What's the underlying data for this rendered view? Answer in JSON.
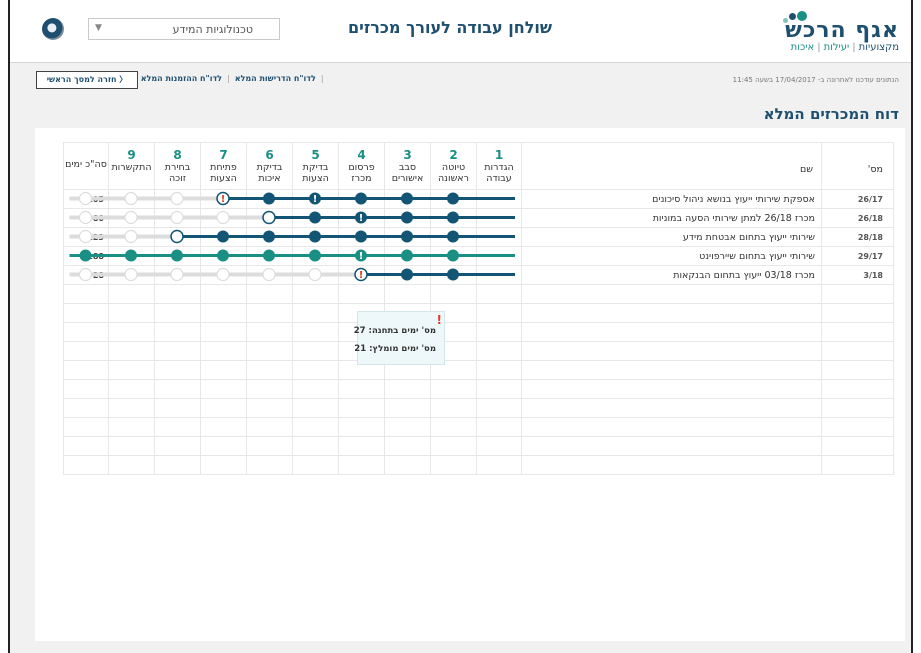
{
  "header": {
    "logo_name": "אגף הרכש",
    "logo_tagline": [
      "מקצועיות",
      "יעילות",
      "איכות"
    ],
    "app_title": "שולחן עבודה לעורך מכרזים",
    "department_select": "טכנולוגיות המידע"
  },
  "toolbar": {
    "last_updated": "הנתונים עודכנו לאחרונה ב- 17/04/2017 בשעה 11:45",
    "link_requirements": "לדו\"ח הדרישות המלא",
    "link_orders": "לדו\"ח ההזמנות המלא",
    "back_button": "חזרה למסך הראשי"
  },
  "report_title": "דוח המכרזים המלא",
  "table": {
    "col_num": "מס'",
    "col_name": "שם",
    "col_total": "סה\"כ ימים",
    "stages": [
      {
        "num": "1",
        "label": "הגדרות עבודה"
      },
      {
        "num": "2",
        "label": "טיוטה ראשונה"
      },
      {
        "num": "3",
        "label": "סבב אישורים"
      },
      {
        "num": "4",
        "label": "פרסום מכרז"
      },
      {
        "num": "5",
        "label": "בדיקת הצעות"
      },
      {
        "num": "6",
        "label": "בדיקת איכות"
      },
      {
        "num": "7",
        "label": "פתיחת הצעות"
      },
      {
        "num": "8",
        "label": "בחירת זוכה"
      },
      {
        "num": "9",
        "label": "התקשרות"
      }
    ],
    "rows": [
      {
        "num": "26/17",
        "name": "אספקת שירותי ייעוץ בנושא ניהול סיכונים",
        "total": "105",
        "completed": 5,
        "current": 6,
        "alerts": [
          4,
          6
        ],
        "color": "#135574"
      },
      {
        "num": "26/18",
        "name": "מכרז 26/18 למתן שירותי הסעה במוניות",
        "total": "80",
        "completed": 4,
        "current": 5,
        "alerts": [
          3
        ],
        "color": "#135574"
      },
      {
        "num": "28/18",
        "name": "שירותי ייעוץ בתחום אבטחת מידע",
        "total": "123",
        "completed": 6,
        "current": 7,
        "alerts": [],
        "color": "#135574"
      },
      {
        "num": "29/17",
        "name": "שירותי ייעוץ בתחום שיירפוינט",
        "total": "188",
        "completed": 9,
        "current": 0,
        "alerts": [
          3
        ],
        "color": "#1a8f84"
      },
      {
        "num": "3/18",
        "name": "מכרז 03/18 ייעוץ בתחום הבנקאות",
        "total": "28",
        "completed": 2,
        "current": 3,
        "alerts": [
          3
        ],
        "color": "#135574"
      }
    ],
    "empty_rows": 10
  },
  "tooltip": {
    "days_in_stage": "מס' ימים בתחנה: 27",
    "recommended_days": "מס' ימים מומלץ: 21"
  },
  "colors": {
    "primary": "#135574",
    "teal": "#1a8f84",
    "alert": "#e03b2a",
    "inactive": "#d8d8d8"
  }
}
